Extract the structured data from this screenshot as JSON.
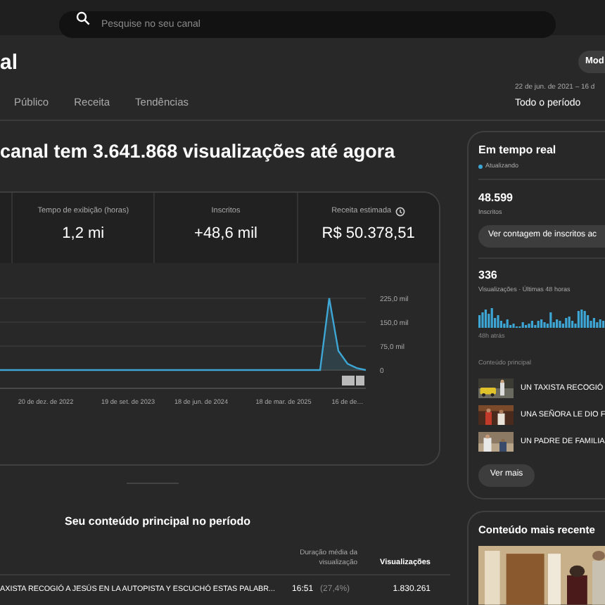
{
  "search": {
    "placeholder": "Pesquise no seu canal"
  },
  "header": {
    "title": "al",
    "button": "Mod",
    "date_range": "22 de jun. de 2021 – 16 d",
    "period": "Todo o período"
  },
  "tabs": [
    {
      "label": "Público",
      "selected": false
    },
    {
      "label": "Receita",
      "selected": false
    },
    {
      "label": "Tendências",
      "selected": false
    }
  ],
  "headline": "canal tem 3.641.868 visualizações até agora",
  "metrics": [
    {
      "kind": "plain",
      "label": "Tempo de exibição (horas)",
      "value": "1,2 mi"
    },
    {
      "kind": "plain",
      "label": "Inscritos",
      "value": "+48,6 mil"
    },
    {
      "kind": "info",
      "label": "Receita estimada",
      "value": "R$ 50.378,51"
    }
  ],
  "chart_data": {
    "type": "line",
    "categories": [
      null,
      null,
      null,
      null,
      null,
      "20 de dez. de 2022",
      null,
      null,
      null,
      null,
      null,
      null,
      null,
      null,
      "19 de set. de 2023",
      null,
      null,
      null,
      null,
      null,
      null,
      null,
      "18 de jun. de 2024",
      null,
      null,
      null,
      null,
      null,
      null,
      null,
      null,
      "18 de mar. de 2025",
      null,
      null,
      null,
      null,
      null,
      null,
      "16 de de…",
      null,
      null
    ],
    "series": [
      {
        "color": "#3ea6d4",
        "values": [
          0,
          0,
          0,
          0,
          0,
          0,
          0,
          0,
          0,
          0,
          0,
          0,
          0,
          0,
          0,
          0,
          0,
          0,
          0,
          0,
          0,
          0,
          0,
          0,
          0,
          0,
          0,
          0,
          0,
          0,
          0,
          0,
          0,
          0,
          0,
          0,
          225,
          60,
          20,
          6,
          0
        ]
      }
    ],
    "ylim": [
      0,
      225
    ],
    "yticks": [
      {
        "value": 0,
        "label": "0"
      },
      {
        "value": 75,
        "label": "75,0 mil"
      },
      {
        "value": 150,
        "label": "150,0 mil"
      },
      {
        "value": 225,
        "label": "225,0 mil"
      }
    ]
  },
  "top_content": {
    "title": "Seu conteúdo principal no período",
    "columns": [
      "Duração média da visualização",
      "Visualizações"
    ],
    "rows": [
      {
        "title": "AXISTA RECOGIÓ A JESÚS EN LA AUTOPISTA Y ESCUCHÓ ESTAS PALABR...",
        "duration": "16:51",
        "percent": "(27,4%)",
        "views": "1.830.261"
      }
    ]
  },
  "realtime": {
    "title": "Em tempo real",
    "status": "Atualizando",
    "subscribers": "48.599",
    "subscribers_label": "Inscritos",
    "subscribers_button": "Ver contagem de inscritos ac",
    "views": "336",
    "views_label": "Visualizações · Últimas 48 horas",
    "axis_label": "48h atrás",
    "section_label": "Conteúdo principal",
    "items": [
      {
        "title": "UN TAXISTA RECOGIÓ",
        "kind": "picture"
      },
      {
        "title": "UNA SEÑORA LE DIO F",
        "kind": "picture"
      },
      {
        "title": "UN PADRE DE FAMILIA",
        "kind": "picture"
      }
    ],
    "more_button": "Ver mais"
  },
  "latest": {
    "title": "Conteúdo mais recente"
  }
}
